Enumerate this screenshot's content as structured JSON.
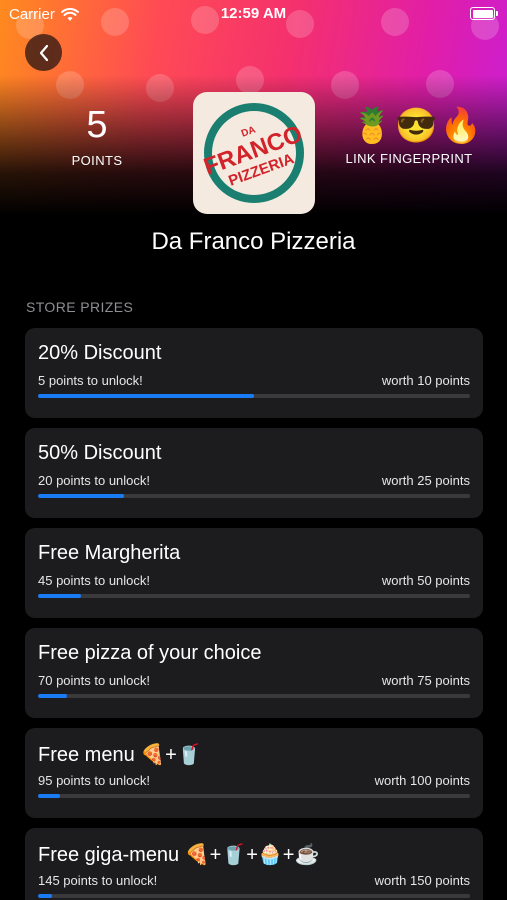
{
  "status_bar": {
    "carrier": "Carrier",
    "time": "12:59 AM"
  },
  "header": {
    "points_value": "5",
    "points_label": "POINTS",
    "emojis": "🍍😎🔥",
    "fingerprint_label": "LINK FINGERPRINT",
    "store_name": "Da Franco Pizzeria",
    "logo_lines": [
      "DA",
      "FRANCO",
      "PIZZERIA"
    ]
  },
  "prizes_section": {
    "title": "STORE PRIZES"
  },
  "prizes": [
    {
      "title": "20% Discount",
      "unlock": "5 points to unlock!",
      "worth": "worth 10 points",
      "progress": 0.5
    },
    {
      "title": "50% Discount",
      "unlock": "20 points to unlock!",
      "worth": "worth 25 points",
      "progress": 0.2
    },
    {
      "title": "Free Margherita",
      "unlock": "45 points to unlock!",
      "worth": "worth 50 points",
      "progress": 0.1
    },
    {
      "title": "Free pizza of your choice",
      "unlock": "70 points to unlock!",
      "worth": "worth 75 points",
      "progress": 0.0667
    },
    {
      "title": "Free menu 🍕+🥤",
      "unlock": "95 points to unlock!",
      "worth": "worth 100 points",
      "progress": 0.05
    },
    {
      "title": "Free giga-menu 🍕+🥤+🧁+☕",
      "unlock": "145 points to unlock!",
      "worth": "worth 150 points",
      "progress": 0.0333
    }
  ],
  "colors": {
    "accent": "#1a7cf5",
    "card_bg": "#1c1c1e",
    "logo_green": "#1a7f70",
    "logo_red": "#d2232a"
  }
}
